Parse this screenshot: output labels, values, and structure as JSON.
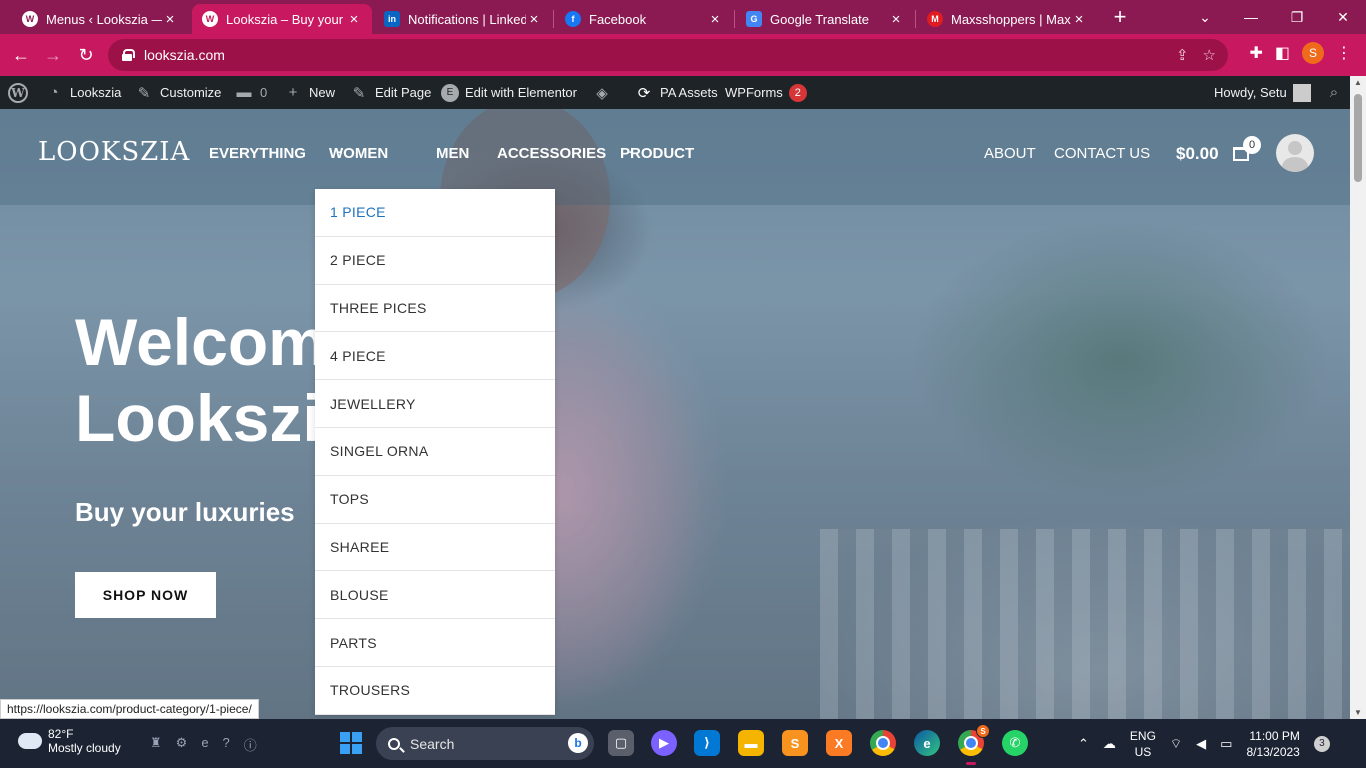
{
  "browser": {
    "tabs": [
      {
        "title": "Menus ‹ Lookszia — WordPress",
        "favicon": "wordpress-icon",
        "active": false
      },
      {
        "title": "Lookszia – Buy your luxuries",
        "favicon": "wordpress-icon",
        "active": true
      },
      {
        "title": "Notifications | LinkedIn",
        "favicon": "linkedin-icon",
        "active": false
      },
      {
        "title": "Facebook",
        "favicon": "facebook-icon",
        "active": false
      },
      {
        "title": "Google Translate",
        "favicon": "google-translate-icon",
        "active": false
      },
      {
        "title": "Maxsshoppers | Maxsshoppers",
        "favicon": "maxsshoppers-icon",
        "active": false
      }
    ],
    "url": "lookszia.com",
    "profile_initial": "S",
    "status_url": "https://lookszia.com/product-category/1-piece/",
    "accent": "#c8185f"
  },
  "adminbar": {
    "site": "Lookszia",
    "customize": "Customize",
    "comments": "0",
    "new": "New",
    "edit_page": "Edit Page",
    "elementor": "Edit with Elementor",
    "pa_assets": "PA Assets",
    "wpforms": "WPForms",
    "wpforms_badge": "2",
    "howdy": "Howdy, Setu"
  },
  "site": {
    "logo": "LOOKSZIA",
    "nav": [
      {
        "label": "EVERYTHING",
        "dropdown": false
      },
      {
        "label": "WOMEN",
        "dropdown": true
      },
      {
        "label": "MEN",
        "dropdown": false
      },
      {
        "label": "ACCESSORIES",
        "dropdown": false
      },
      {
        "label": "PRODUCT",
        "dropdown": true
      }
    ],
    "right_nav": [
      "ABOUT",
      "CONTACT US"
    ],
    "cart_total": "$0.00",
    "cart_count": "0",
    "hero_title_line1": "Welcome to",
    "hero_title_line2": "Lookszia",
    "hero_subtitle": "Buy your luxuries",
    "cta": "SHOP NOW",
    "women_menu": [
      "1 PIECE",
      "2 PIECE",
      "THREE PICES",
      "4 PIECE",
      "JEWELLERY",
      "SINGEL ORNA",
      "TOPS",
      "SHAREE",
      "BLOUSE",
      "PARTS",
      "TROUSERS"
    ],
    "women_menu_active": "1 PIECE",
    "active_color": "#1e73be"
  },
  "taskbar": {
    "weather_temp": "82°F",
    "weather_desc": "Mostly cloudy",
    "search": "Search",
    "lang1": "ENG",
    "lang2": "US",
    "time": "11:00 PM",
    "date": "8/13/2023",
    "notifications": "3"
  }
}
